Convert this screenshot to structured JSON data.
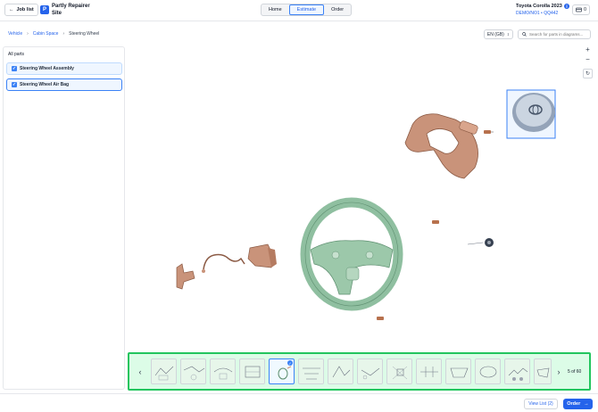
{
  "header": {
    "back_label": "Job list",
    "app_name": "Partly Repairer Site",
    "logo_letter": "P",
    "tabs": [
      {
        "label": "Home",
        "active": false
      },
      {
        "label": "Estimate",
        "active": true
      },
      {
        "label": "Order",
        "active": false
      }
    ],
    "vehicle_name": "Toyota Corolla 2023",
    "vehicle_code": "DEMO/NO1 • QQ442",
    "cart_count": "0"
  },
  "breadcrumb": {
    "items": [
      "Vehicle",
      "Cabin Space",
      "Steering Wheel"
    ]
  },
  "language": "EN (GB)",
  "search": {
    "placeholder": "Search for parts in diagrams..."
  },
  "sidebar": {
    "title": "All parts",
    "items": [
      {
        "label": "Steering Wheel Assembly",
        "selected": false
      },
      {
        "label": "Steering Wheel Air Bag",
        "selected": true
      }
    ]
  },
  "thumbnails": {
    "selected_badge": "✓",
    "page_indicator": "5 of 60"
  },
  "footer": {
    "view_list_label": "View List (2)",
    "order_label": "Order"
  },
  "colors": {
    "accent": "#2563eb",
    "part_copper": "#c9937a",
    "part_green": "#8fbfa0",
    "highlight": "#22c55e"
  }
}
